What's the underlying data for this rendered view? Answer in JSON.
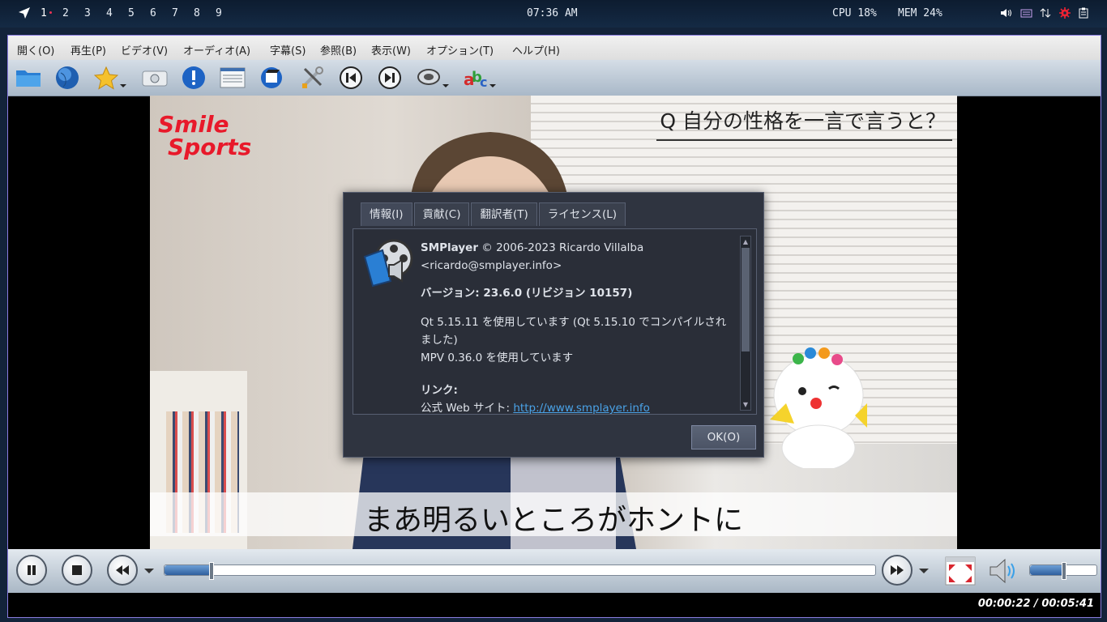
{
  "topbar": {
    "workspaces": [
      "1",
      "2",
      "3",
      "4",
      "5",
      "6",
      "7",
      "8",
      "9"
    ],
    "clock": "07:36 AM",
    "cpu": "CPU 18%",
    "mem": "MEM 24%"
  },
  "menubar": {
    "items": [
      "開く(O)",
      "再生(P)",
      "ビデオ(V)",
      "オーディオ(A)",
      "字幕(S)",
      "参照(B)",
      "表示(W)",
      "オプション(T)",
      "ヘルプ(H)"
    ]
  },
  "toolbar": {
    "icons": [
      "folder-icon",
      "globe-icon",
      "favorites-star-icon",
      "screenshot-camera-icon",
      "info-icon",
      "playlist-icon",
      "video-equalizer-icon",
      "preferences-tools-icon",
      "previous-icon",
      "next-icon",
      "audio-track-icon",
      "subtitle-track-icon"
    ]
  },
  "video": {
    "brand_line1": "Smile",
    "brand_line2": "Sports",
    "question": "Q 自分の性格を一言で言うと？",
    "subtitle": "まあ明るいところがホントに"
  },
  "dialog": {
    "tabs": [
      "情報(I)",
      "貢献(C)",
      "翻訳者(T)",
      "ライセンス(L)"
    ],
    "active_tab": 0,
    "app_name": "SMPlayer",
    "copyright": " © 2006-2023 Ricardo Villalba",
    "email": "<ricardo@smplayer.info>",
    "version": "バージョン: 23.6.0 (リビジョン 10157)",
    "qt_line": "Qt 5.15.11 を使用しています (Qt 5.15.10 でコンパイルされました)",
    "mpv_line": "MPV 0.36.0 を使用しています",
    "links_header": "リンク:",
    "links_partial_label": "公式 Web サイト: ",
    "links_partial_url": "http://www.smplayer.info",
    "ok_label": "OK(O)"
  },
  "controls": {
    "progress": 0.065,
    "volume": 0.5,
    "timecode": "00:00:22 / 00:05:41"
  },
  "colors": {
    "accent_blue": "#2f5f9e",
    "brand_red": "#e8192a",
    "dialog_bg": "#2f3440",
    "link": "#4aa3e8"
  }
}
